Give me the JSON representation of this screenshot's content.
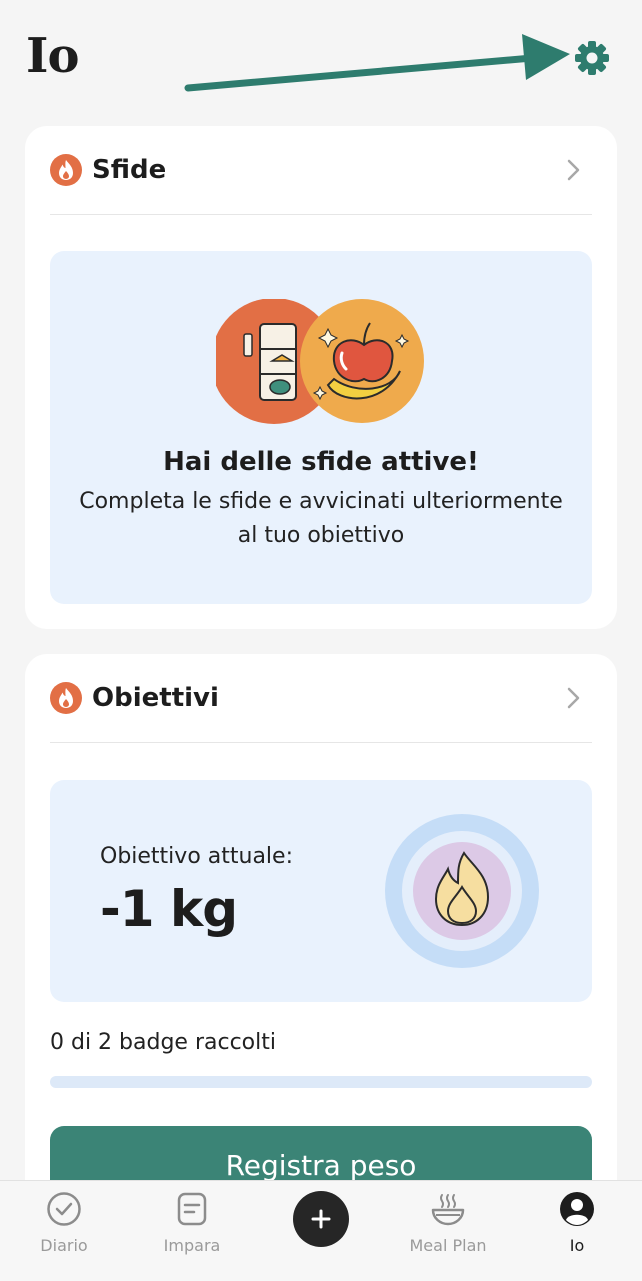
{
  "page": {
    "title": "Io"
  },
  "header": {
    "settings_icon": "gear-icon"
  },
  "colors": {
    "accent": "#3b8476",
    "panel_bg": "#e9f2fd",
    "flame_badge": "#e26f45",
    "progress_track": "#dde9f8"
  },
  "sfide": {
    "title": "Sfide",
    "icon": "flame-icon",
    "heading": "Hai delle sfide attive!",
    "text": "Completa le sfide e avvicinati ulteriormente al tuo obiettivo"
  },
  "obiettivi": {
    "title": "Obiettivi",
    "icon": "flame-icon",
    "goal_label": "Obiettivo attuale:",
    "goal_value": "-1 kg",
    "badges_text": "0 di 2 badge raccolti",
    "badges_collected": 0,
    "badges_total": 2,
    "progress": 0,
    "button_label": "Registra peso"
  },
  "tabbar": {
    "items": [
      {
        "label": "Diario",
        "icon": "check-circle-icon",
        "active": false
      },
      {
        "label": "Impara",
        "icon": "note-icon",
        "active": false
      },
      {
        "label": "",
        "icon": "plus-icon",
        "active": false
      },
      {
        "label": "Meal Plan",
        "icon": "bowl-icon",
        "active": false
      },
      {
        "label": "Io",
        "icon": "profile-icon",
        "active": true
      }
    ]
  }
}
